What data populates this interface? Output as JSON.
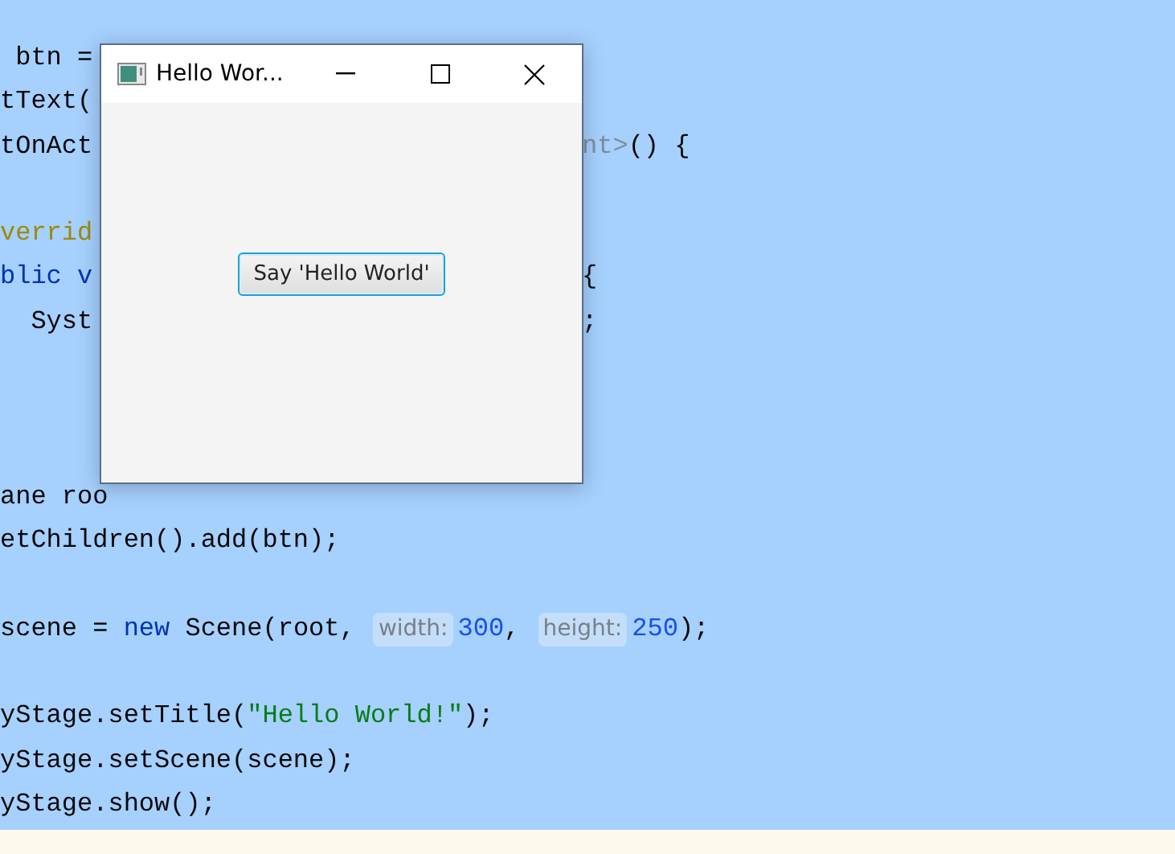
{
  "code_lines": [
    {
      "kind": "code",
      "left": [
        {
          "text": " btn = ",
          "kind": "plain"
        }
      ]
    },
    {
      "kind": "code",
      "left": [
        {
          "text": "tText(",
          "kind": "plain"
        }
      ]
    },
    {
      "kind": "code",
      "left": [
        {
          "text": "tOnAct",
          "kind": "plain"
        }
      ],
      "right": [
        {
          "text": "nt>",
          "kind": "muted"
        },
        {
          "text": "() {",
          "kind": "plain"
        }
      ]
    },
    {
      "kind": "blank"
    },
    {
      "kind": "code",
      "left": [
        {
          "text": "verrid",
          "kind": "annotation"
        }
      ]
    },
    {
      "kind": "code",
      "left": [
        {
          "text": "blic v",
          "kind": "keyword"
        }
      ],
      "right": [
        {
          "text": "{",
          "kind": "plain"
        }
      ]
    },
    {
      "kind": "code",
      "left": [
        {
          "text": "  Syst",
          "kind": "plain"
        }
      ],
      "right": [
        {
          "text": ";",
          "kind": "plain"
        }
      ]
    },
    {
      "kind": "blank"
    },
    {
      "kind": "blank"
    },
    {
      "kind": "blank"
    },
    {
      "kind": "code",
      "left": [
        {
          "text": "ane roo",
          "kind": "plain"
        }
      ]
    },
    {
      "kind": "code",
      "left": [
        {
          "text": "etChildren().add(btn);",
          "kind": "plain"
        }
      ]
    },
    {
      "kind": "blank"
    },
    {
      "kind": "code",
      "left": [
        {
          "text": "scene = ",
          "kind": "plain"
        },
        {
          "text": "new",
          "kind": "keyword"
        },
        {
          "text": " Scene(root, ",
          "kind": "plain"
        },
        {
          "text": "width:",
          "kind": "hint"
        },
        {
          "text": "300",
          "kind": "number"
        },
        {
          "text": ", ",
          "kind": "plain"
        },
        {
          "text": "height:",
          "kind": "hint"
        },
        {
          "text": "250",
          "kind": "number"
        },
        {
          "text": ");",
          "kind": "plain"
        }
      ]
    },
    {
      "kind": "blank"
    },
    {
      "kind": "code",
      "left": [
        {
          "text": "yStage.setTitle(",
          "kind": "plain"
        },
        {
          "text": "\"Hello World!\"",
          "kind": "string"
        },
        {
          "text": ");",
          "kind": "plain"
        }
      ]
    },
    {
      "kind": "code",
      "left": [
        {
          "text": "yStage.setScene(scene);",
          "kind": "plain"
        }
      ]
    },
    {
      "kind": "code",
      "left": [
        {
          "text": "yStage.show();",
          "kind": "plain"
        }
      ]
    }
  ],
  "window": {
    "title": "Hello Wor...",
    "button": "Say 'Hello World'"
  }
}
